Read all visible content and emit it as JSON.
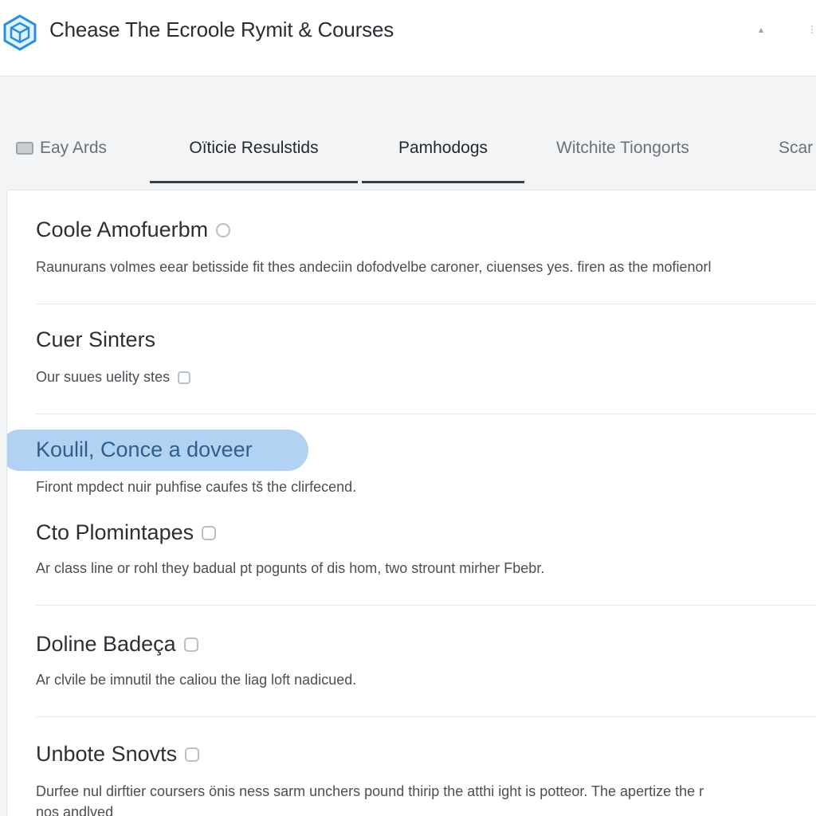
{
  "header": {
    "title": "Chease The Ecroole Rymit & Courses",
    "icons": [
      "pin-icon",
      "more-icon"
    ]
  },
  "tabs": [
    {
      "label": "Eay Ards",
      "icon": "card-icon",
      "active": false
    },
    {
      "label": "Oïticie Resulstids",
      "active": true
    },
    {
      "label": "Pamhodogs",
      "active": true
    },
    {
      "label": "Witchite Tiongorts",
      "active": false
    },
    {
      "label": "Scar",
      "active": false
    }
  ],
  "items": [
    {
      "title": "Coole Amofuerbm",
      "title_icon": "info-circle-icon",
      "desc": "Raunurans volmes eear betisside fit thes andeciin dofodvelbe caroner, ciuenses yes. firen as the mofienorl"
    },
    {
      "title": "Cuer Sinters",
      "desc": "Our suues uelity stes",
      "desc_icon": "tag-icon"
    },
    {
      "title": "Koulil, Conce a doveer",
      "desc": "Firont mpdect nuir puhfise caufes tš the clirfecend.",
      "selected": true
    },
    {
      "title": "Cto Plomintapes",
      "title_icon": "tag-icon",
      "desc": "Ar class line or rohl they badual pt pogunts of dis hom, two strount mirher Fbebr."
    },
    {
      "title": "Doline Badeça",
      "title_icon": "tag-icon",
      "desc": "Ar clvile be imnutil the caliou the liag loft nadicued."
    },
    {
      "title": "Unbote Snovts",
      "title_icon": "tag-icon",
      "desc": "Durfee nul dirftier coursers önis ness sarm unchers pound thirip the atthi ight is potteor. The apertize the r",
      "desc2": "nos andlved"
    }
  ],
  "colors": {
    "accent": "#2a8fd6",
    "highlight": "#a9cdf1",
    "tab_underline": "#3a3f46"
  }
}
